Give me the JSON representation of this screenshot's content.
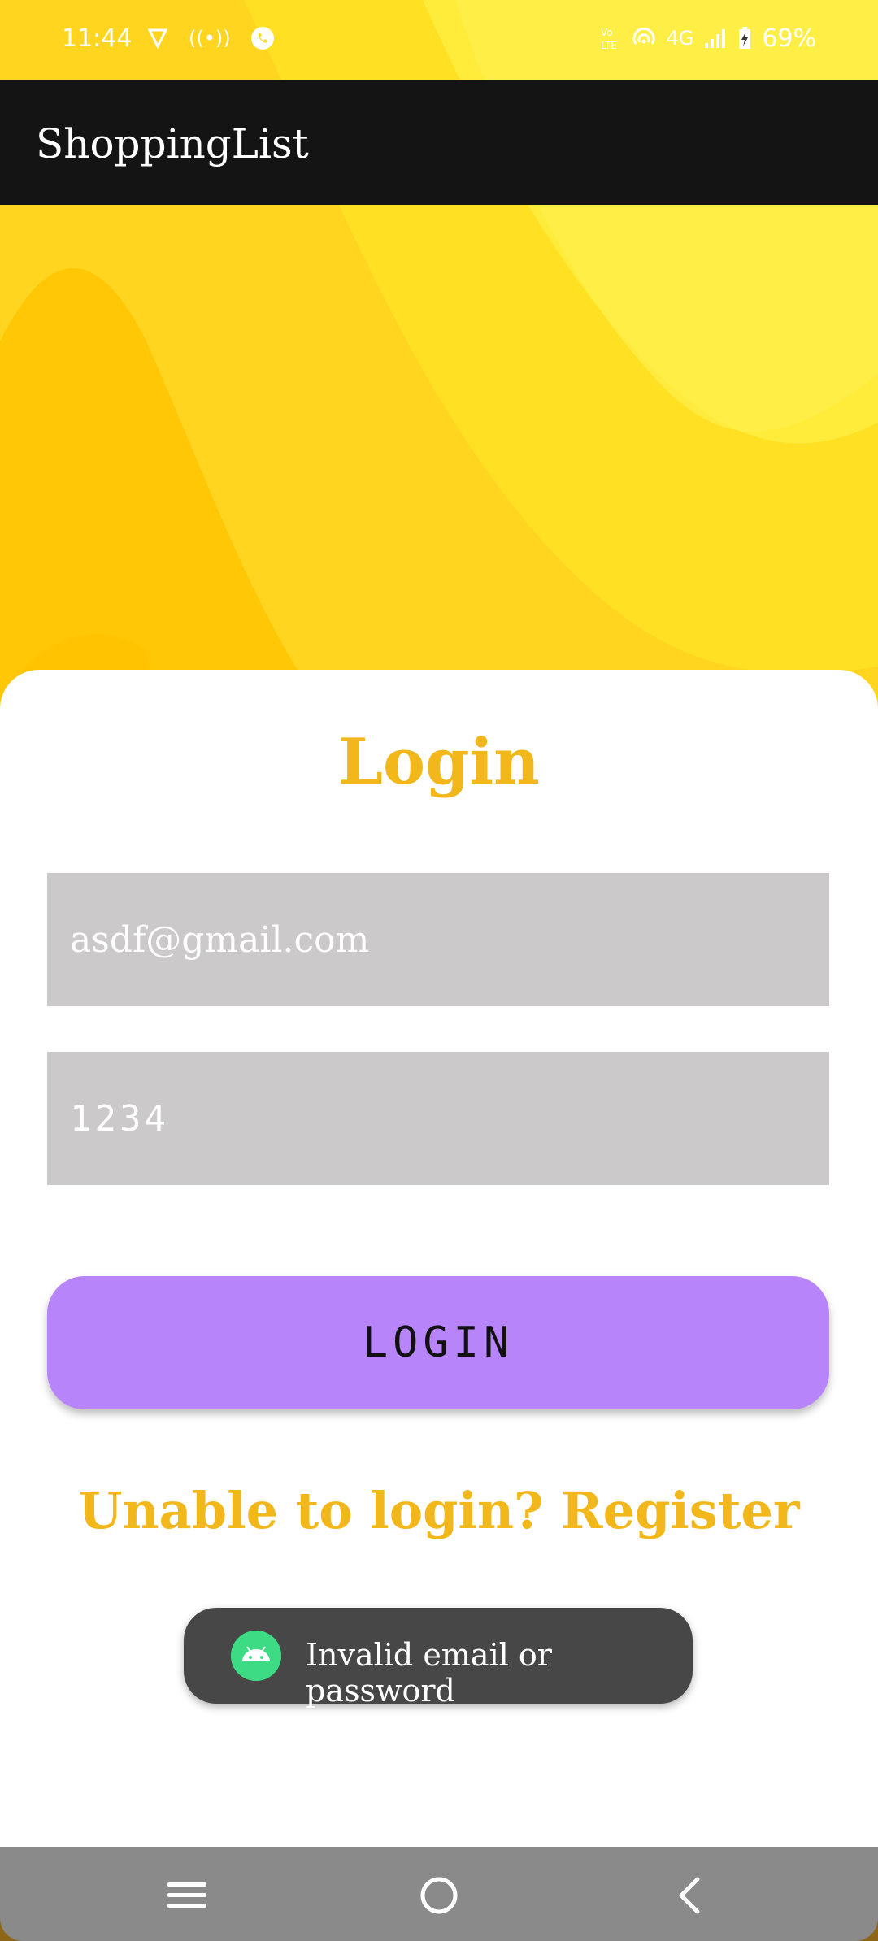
{
  "status_bar": {
    "time": "11:44",
    "network": "4G",
    "battery": "69%"
  },
  "app_bar": {
    "title": "ShoppingList"
  },
  "login": {
    "title": "Login",
    "email_value": "asdf@gmail.com",
    "password_value": "1234",
    "button_label": "LOGIN",
    "register_link": "Unable to login? Register"
  },
  "toast": {
    "message": "Invalid email or password"
  },
  "colors": {
    "accent": "#f2b71a",
    "button": "#b785f9",
    "field": "#cbc9ca",
    "appbar": "#141414"
  }
}
